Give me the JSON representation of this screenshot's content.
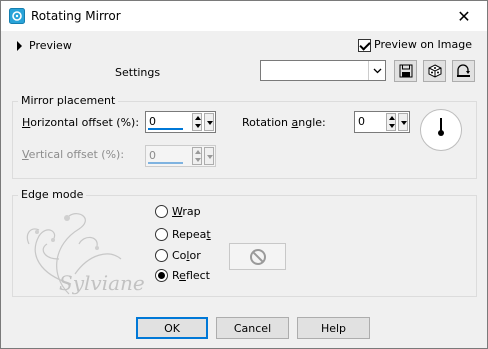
{
  "window": {
    "title": "Rotating Mirror",
    "close_glyph": "✕"
  },
  "preview": {
    "label": "Preview",
    "on_image_label": "Preview on Image",
    "on_image_checked": true
  },
  "settings": {
    "label": "Settings",
    "value": ""
  },
  "mirror_placement": {
    "title": "Mirror placement",
    "horizontal_offset": {
      "accel": "H",
      "label_rest": "orizontal offset (%):",
      "value": "0"
    },
    "vertical_offset": {
      "accel": "V",
      "label_rest": "ertical offset (%):",
      "value": "0",
      "disabled": true
    },
    "rotation_angle": {
      "label_pre": "Rotation ",
      "accel": "a",
      "label_rest": "ngle:",
      "value": "0"
    }
  },
  "edge_mode": {
    "title": "Edge mode",
    "options": [
      {
        "accel": "W",
        "rest": "rap",
        "checked": false
      },
      {
        "pre": "Repea",
        "accel": "t",
        "rest": "",
        "checked": false
      },
      {
        "pre": "Co",
        "accel": "l",
        "rest": "or",
        "checked": false
      },
      {
        "pre": "R",
        "accel": "e",
        "rest": "flect",
        "checked": true
      }
    ]
  },
  "buttons": {
    "ok": "OK",
    "cancel": "Cancel",
    "help": "Help"
  },
  "colors": {
    "accent": "#0078d7",
    "window_bg": "#f0f0f0",
    "button_bg": "#e1e1e1"
  }
}
